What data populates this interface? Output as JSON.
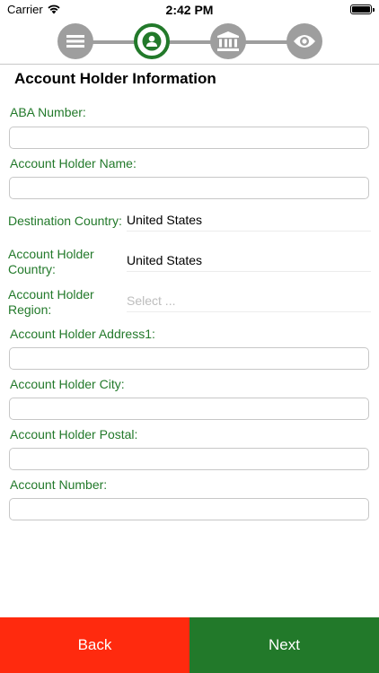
{
  "status_bar": {
    "carrier": "Carrier",
    "time": "2:42 PM"
  },
  "stepper": {
    "steps": [
      {
        "icon": "list-icon",
        "active": false
      },
      {
        "icon": "person-icon",
        "active": true
      },
      {
        "icon": "bank-icon",
        "active": false
      },
      {
        "icon": "eye-icon",
        "active": false
      }
    ],
    "active_color": "#22792a",
    "inactive_color": "#9e9e9e"
  },
  "section_title": "Account Holder Information",
  "form": {
    "aba_number": {
      "label": "ABA Number:",
      "value": ""
    },
    "holder_name": {
      "label": "Account Holder Name:",
      "value": ""
    },
    "destination_country": {
      "label": "Destination Country:",
      "value": "United States"
    },
    "holder_country": {
      "label_line1": "Account Holder",
      "label_line2": "Country:",
      "value": "United States"
    },
    "holder_region": {
      "label_line1": "Account Holder",
      "label_line2": "Region:",
      "placeholder": "Select ..."
    },
    "holder_address1": {
      "label": "Account Holder Address1:",
      "value": ""
    },
    "holder_city": {
      "label": "Account Holder City:",
      "value": ""
    },
    "holder_postal": {
      "label": "Account Holder Postal:",
      "value": ""
    },
    "account_number": {
      "label": "Account Number:",
      "value": ""
    }
  },
  "buttons": {
    "back": "Back",
    "next": "Next"
  },
  "colors": {
    "label_green": "#22792a",
    "back_red": "#ff2a0e",
    "next_green": "#22792a"
  }
}
